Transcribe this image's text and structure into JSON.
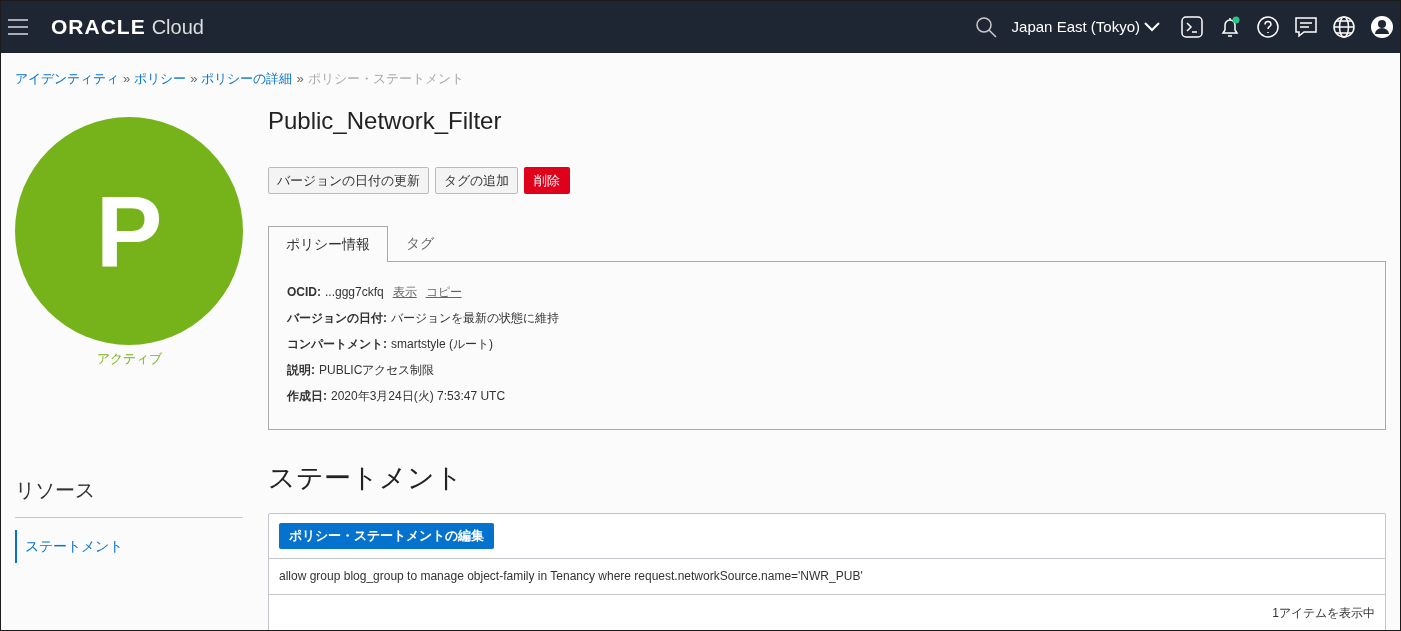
{
  "header": {
    "logo_brand": "ORACLE",
    "logo_product": "Cloud",
    "region": "Japan East (Tokyo)",
    "notification_dot": true
  },
  "breadcrumb": [
    {
      "label": "アイデンティティ",
      "kind": "link"
    },
    {
      "label": "ポリシー",
      "kind": "link"
    },
    {
      "label": "ポリシーの詳細",
      "kind": "link"
    },
    {
      "label": "ポリシー・ステートメント",
      "kind": "current"
    }
  ],
  "breadcrumb_separator": "»",
  "avatar": {
    "letter": "P",
    "status": "アクティブ"
  },
  "title": "Public_Network_Filter",
  "actions": [
    {
      "label": "バージョンの日付の更新",
      "kind": "default"
    },
    {
      "label": "タグの追加",
      "kind": "default"
    },
    {
      "label": "削除",
      "kind": "danger"
    }
  ],
  "tabs": [
    {
      "label": "ポリシー情報",
      "selected": true
    },
    {
      "label": "タグ",
      "selected": false
    }
  ],
  "details": [
    {
      "label": "OCID:",
      "value": "...ggg7ckfq",
      "links": [
        "表示",
        "コピー"
      ]
    },
    {
      "label": "バージョンの日付:",
      "value": "バージョンを最新の状態に維持"
    },
    {
      "label": "コンパートメント:",
      "value": "smartstyle (ルート)"
    },
    {
      "label": "説明:",
      "value": "PUBLICアクセス制限"
    },
    {
      "label": "作成日:",
      "value": "2020年3月24日(火) 7:53:47 UTC"
    }
  ],
  "resources": {
    "heading": "リソース",
    "items": [
      {
        "label": "ステートメント",
        "selected": true
      }
    ]
  },
  "statements": {
    "heading": "ステートメント",
    "edit_button": "ポリシー・ステートメントの編集",
    "rows": [
      "allow group blog_group to manage object-family in Tenancy where request.networkSource.name='NWR_PUB'"
    ],
    "footer": "1アイテムを表示中"
  }
}
